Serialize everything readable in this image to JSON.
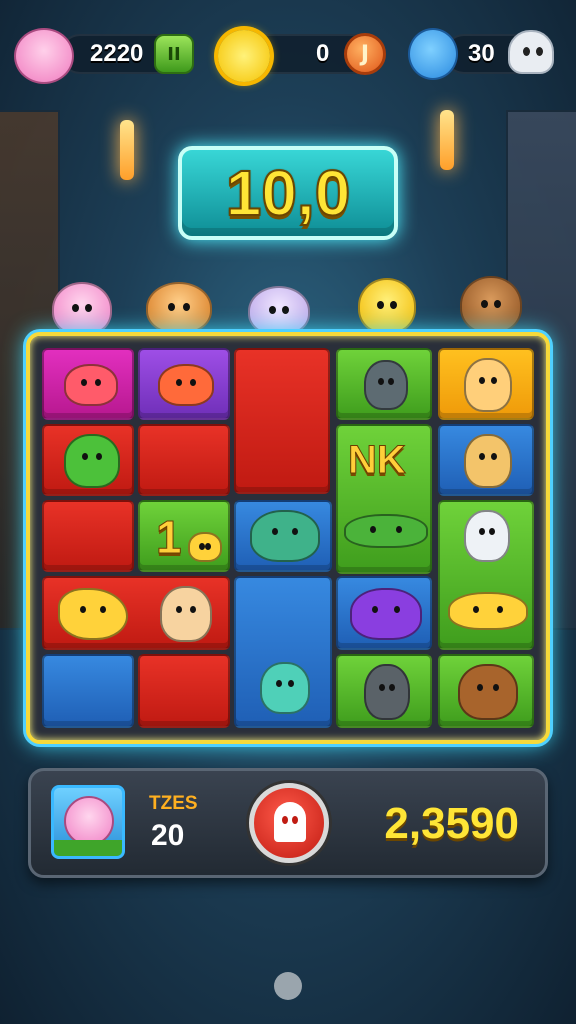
{
  "top_bar": {
    "pet_currency": "2220",
    "coin_currency": "0",
    "ghost_currency": "30",
    "coin_symbol": "J",
    "pause_symbol": "II"
  },
  "score_banner": "10,0",
  "board": {
    "tile_text_1": "NK",
    "tile_text_2": "1"
  },
  "bottom_panel": {
    "label": "TZES",
    "count": "20",
    "score": "2,3590"
  },
  "colors": {
    "pink": "#e22fbf",
    "purple": "#9e4ee6",
    "red": "#e83227",
    "green": "#6fd23a",
    "yellow": "#ffc01f",
    "blue": "#3789e0",
    "board_glow": "#3fe2ff",
    "score_yellow": "#ffe536"
  }
}
